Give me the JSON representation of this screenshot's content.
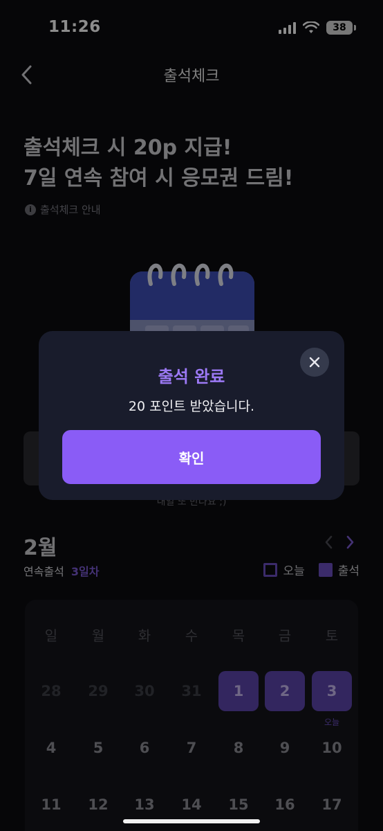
{
  "status_bar": {
    "time": "11:26",
    "battery": "38"
  },
  "header": {
    "title": "출석체크",
    "back_icon": "chevron-left-icon"
  },
  "promo": {
    "line1": "출석체크 시 20p 지급!",
    "line2": "7일 연속 참여 시 응모권 드림!",
    "info_label": "출석체크 안내",
    "info_icon": "info-icon"
  },
  "behind_text": "내일 또 만나요 ;)",
  "calendar": {
    "month": "2월",
    "streak_label": "연속출석",
    "streak_value": "3일차",
    "legend_today": "오늘",
    "legend_attended": "출석",
    "weekdays": [
      "일",
      "월",
      "화",
      "수",
      "목",
      "금",
      "토"
    ],
    "rows": [
      [
        "28",
        "29",
        "30",
        "31",
        "1",
        "2",
        "3"
      ],
      [
        "4",
        "5",
        "6",
        "7",
        "8",
        "9",
        "10"
      ],
      [
        "11",
        "12",
        "13",
        "14",
        "15",
        "16",
        "17"
      ]
    ],
    "today_label": "오늘",
    "accent_color": "#6c4fc2"
  },
  "modal": {
    "title": "출석 완료",
    "message": "20 포인트 받았습니다.",
    "confirm_label": "확인",
    "close_icon": "close-icon",
    "accent_color": "#8a5cf6"
  }
}
